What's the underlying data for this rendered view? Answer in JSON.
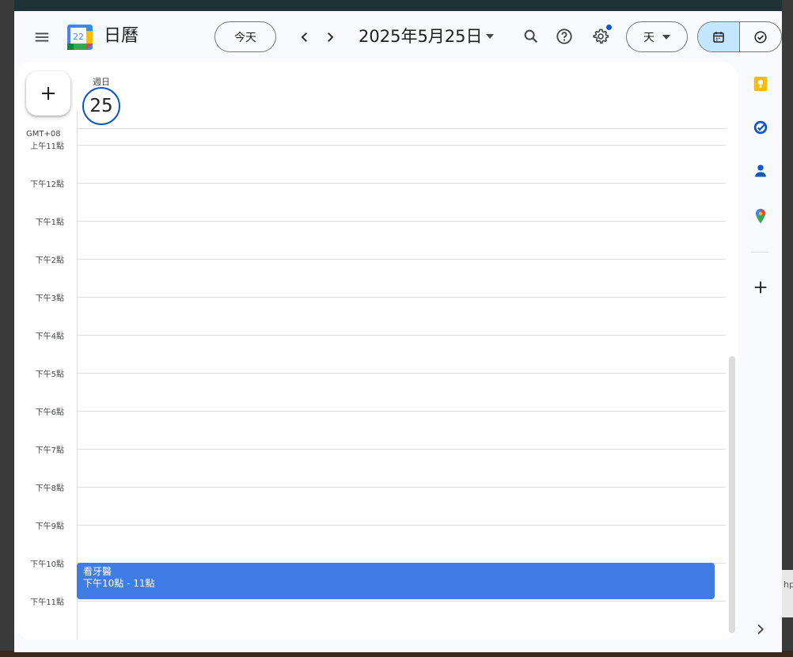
{
  "app": {
    "title": "日曆"
  },
  "header": {
    "logo_day": "22",
    "today_label": "今天",
    "date_title": "2025年5月25日",
    "view_label": "天"
  },
  "day": {
    "name": "週日",
    "number": "25"
  },
  "timezone": "GMT+08",
  "hours": [
    "上午11點",
    "下午12點",
    "下午1點",
    "下午2點",
    "下午3點",
    "下午4點",
    "下午5點",
    "下午6點",
    "下午7點",
    "下午8點",
    "下午9點",
    "下午10點",
    "下午11點"
  ],
  "events": [
    {
      "title": "看牙醫",
      "time": "下午10點 - 11點",
      "color": "#3f7ce6"
    }
  ],
  "side_icons": [
    "keep-icon",
    "tasks-icon",
    "contacts-icon",
    "maps-icon",
    "add-icon"
  ],
  "background_fragment": "hp",
  "colors": {
    "accent": "#0b57d0",
    "event": "#3f7ce6",
    "toggle_active": "#c2e7ff"
  }
}
